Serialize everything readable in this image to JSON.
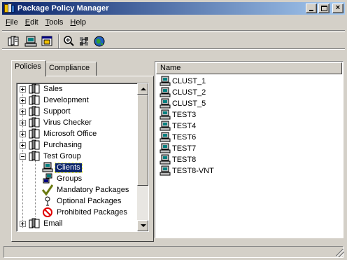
{
  "window": {
    "title": "Package Policy Manager",
    "accent": "#0a246a"
  },
  "title_buttons": {
    "minimize": "minimize-icon",
    "maximize": "maximize-icon",
    "close": "×"
  },
  "menu": {
    "items": [
      {
        "label": "File",
        "u": "F",
        "rest": "ile"
      },
      {
        "label": "Edit",
        "u": "E",
        "rest": "dit"
      },
      {
        "label": "Tools",
        "u": "T",
        "rest": "ools"
      },
      {
        "label": "Help",
        "u": "H",
        "rest": "elp"
      }
    ]
  },
  "toolbar": {
    "buttons": [
      "new-policy-icon",
      "computer-icon",
      "package-icon",
      "zoom-icon",
      "tools-icon",
      "globe-icon"
    ]
  },
  "tabs": {
    "policies": "Policies",
    "compliance": "Compliance"
  },
  "tree": {
    "items": [
      {
        "label": "Sales",
        "expander": "+"
      },
      {
        "label": "Development",
        "expander": "+"
      },
      {
        "label": "Support",
        "expander": "+"
      },
      {
        "label": "Virus Checker",
        "expander": "+"
      },
      {
        "label": "Microsoft Office",
        "expander": "+"
      },
      {
        "label": "Purchasing",
        "expander": "+"
      },
      {
        "label": "Test Group",
        "expander": "-"
      },
      {
        "label": "Clients",
        "selected": true
      },
      {
        "label": "Groups"
      },
      {
        "label": "Mandatory Packages"
      },
      {
        "label": "Optional Packages"
      },
      {
        "label": "Prohibited Packages"
      },
      {
        "label": "Email",
        "expander": "+"
      }
    ]
  },
  "list": {
    "column": "Name",
    "items": [
      "CLUST_1",
      "CLUST_2",
      "CLUST_5",
      "TEST3",
      "TEST4",
      "TEST6",
      "TEST7",
      "TEST8",
      "TEST8-VNT"
    ]
  },
  "status": {
    "text": ""
  }
}
